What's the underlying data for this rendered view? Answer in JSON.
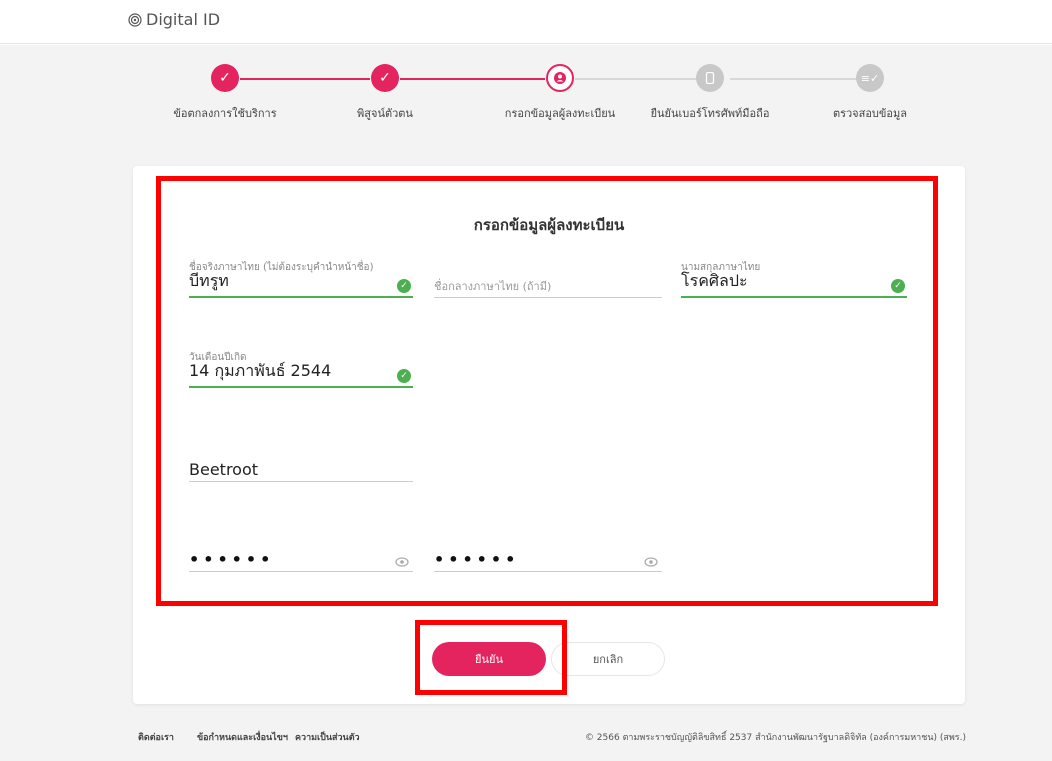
{
  "header": {
    "brand": "Digital ID",
    "brand_icon": "fingerprint-icon"
  },
  "stepper": {
    "steps": [
      {
        "label": "ข้อตกลงการใช้บริการ",
        "status": "done",
        "icon": "check-icon"
      },
      {
        "label": "พิสูจน์ตัวตน",
        "status": "done",
        "icon": "check-icon"
      },
      {
        "label": "กรอกข้อมูลผู้ลงทะเบียน",
        "status": "active",
        "icon": "user-icon"
      },
      {
        "label": "ยืนยันเบอร์โทรศัพท์มือถือ",
        "status": "pending",
        "icon": "phone-icon"
      },
      {
        "label": "ตรวจสอบข้อมูล",
        "status": "pending",
        "icon": "checklist-icon"
      }
    ]
  },
  "form": {
    "title": "กรอกข้อมูลผู้ลงทะเบียน",
    "first_name": {
      "label": "ชื่อจริงภาษาไทย (ไม่ต้องระบุคำนำหน้าชื่อ)",
      "value": "บีทรูท"
    },
    "middle_name": {
      "placeholder": "ชื่อกลางภาษาไทย (ถ้ามี)"
    },
    "last_name": {
      "label": "นามสกุลภาษาไทย",
      "value": "โรคศิลปะ"
    },
    "birthdate": {
      "label": "วันเดือนปีเกิด",
      "value": "14 กุมภาพันธ์ 2544"
    },
    "username": {
      "value": "Beetroot"
    },
    "password": {
      "value": "••••••"
    },
    "confirm_password": {
      "value": "••••••"
    }
  },
  "actions": {
    "confirm_label": "ยืนยัน",
    "cancel_label": "ยกเลิก"
  },
  "footer": {
    "contact": "ติดต่อเรา",
    "terms": "ข้อกำหนดและเงื่อนไขฯ",
    "privacy": "ความเป็นส่วนตัว",
    "copyright": "© 2566 ตามพระราชบัญญัติลิขสิทธิ์ 2537 สำนักงานพัฒนารัฐบาลดิจิทัล (องค์การมหาชน) (สพร.)"
  },
  "colors": {
    "accent": "#e4245e",
    "valid": "#4caf50",
    "highlight": "#ff0000",
    "pending": "#c8c8c8"
  }
}
